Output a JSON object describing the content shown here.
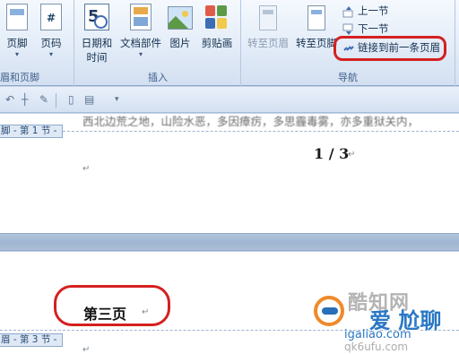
{
  "ribbon": {
    "groups": {
      "header_footer": "眉和页脚",
      "insert": "插入",
      "navigation": "导航"
    },
    "buttons": {
      "footer": "页脚",
      "page_number": "页码",
      "date_time_line1": "日期和",
      "date_time_line2": "时间",
      "quick_parts": "文档部件",
      "picture": "图片",
      "clip_art": "剪贴画",
      "goto_header": "转至页眉",
      "goto_footer": "转至页脚",
      "previous_section": "上一节",
      "next_section": "下一节",
      "link_to_previous": "链接到前一条页眉"
    },
    "calendar_glyph": "5",
    "hash_glyph": "#"
  },
  "document": {
    "page1_body_text": "西北边荒之地，山险水恶，多因瘴疠，多思霾毒雾，亦多重狱关内，",
    "footer_section1_tag": "脚 - 第 1 节 -",
    "page_number_text": "1 / 3",
    "page3_title": "第三页",
    "header_section3_tag": "眉 - 第 3 节 -"
  },
  "watermark": {
    "cn_top": "酷知网",
    "cn_main": "爱 尬聊",
    "url_main": "igaliao.com",
    "url_sub": "qk6ufu.com"
  },
  "colors": {
    "highlight": "#d42020",
    "ribbon_text": "#15304f"
  }
}
